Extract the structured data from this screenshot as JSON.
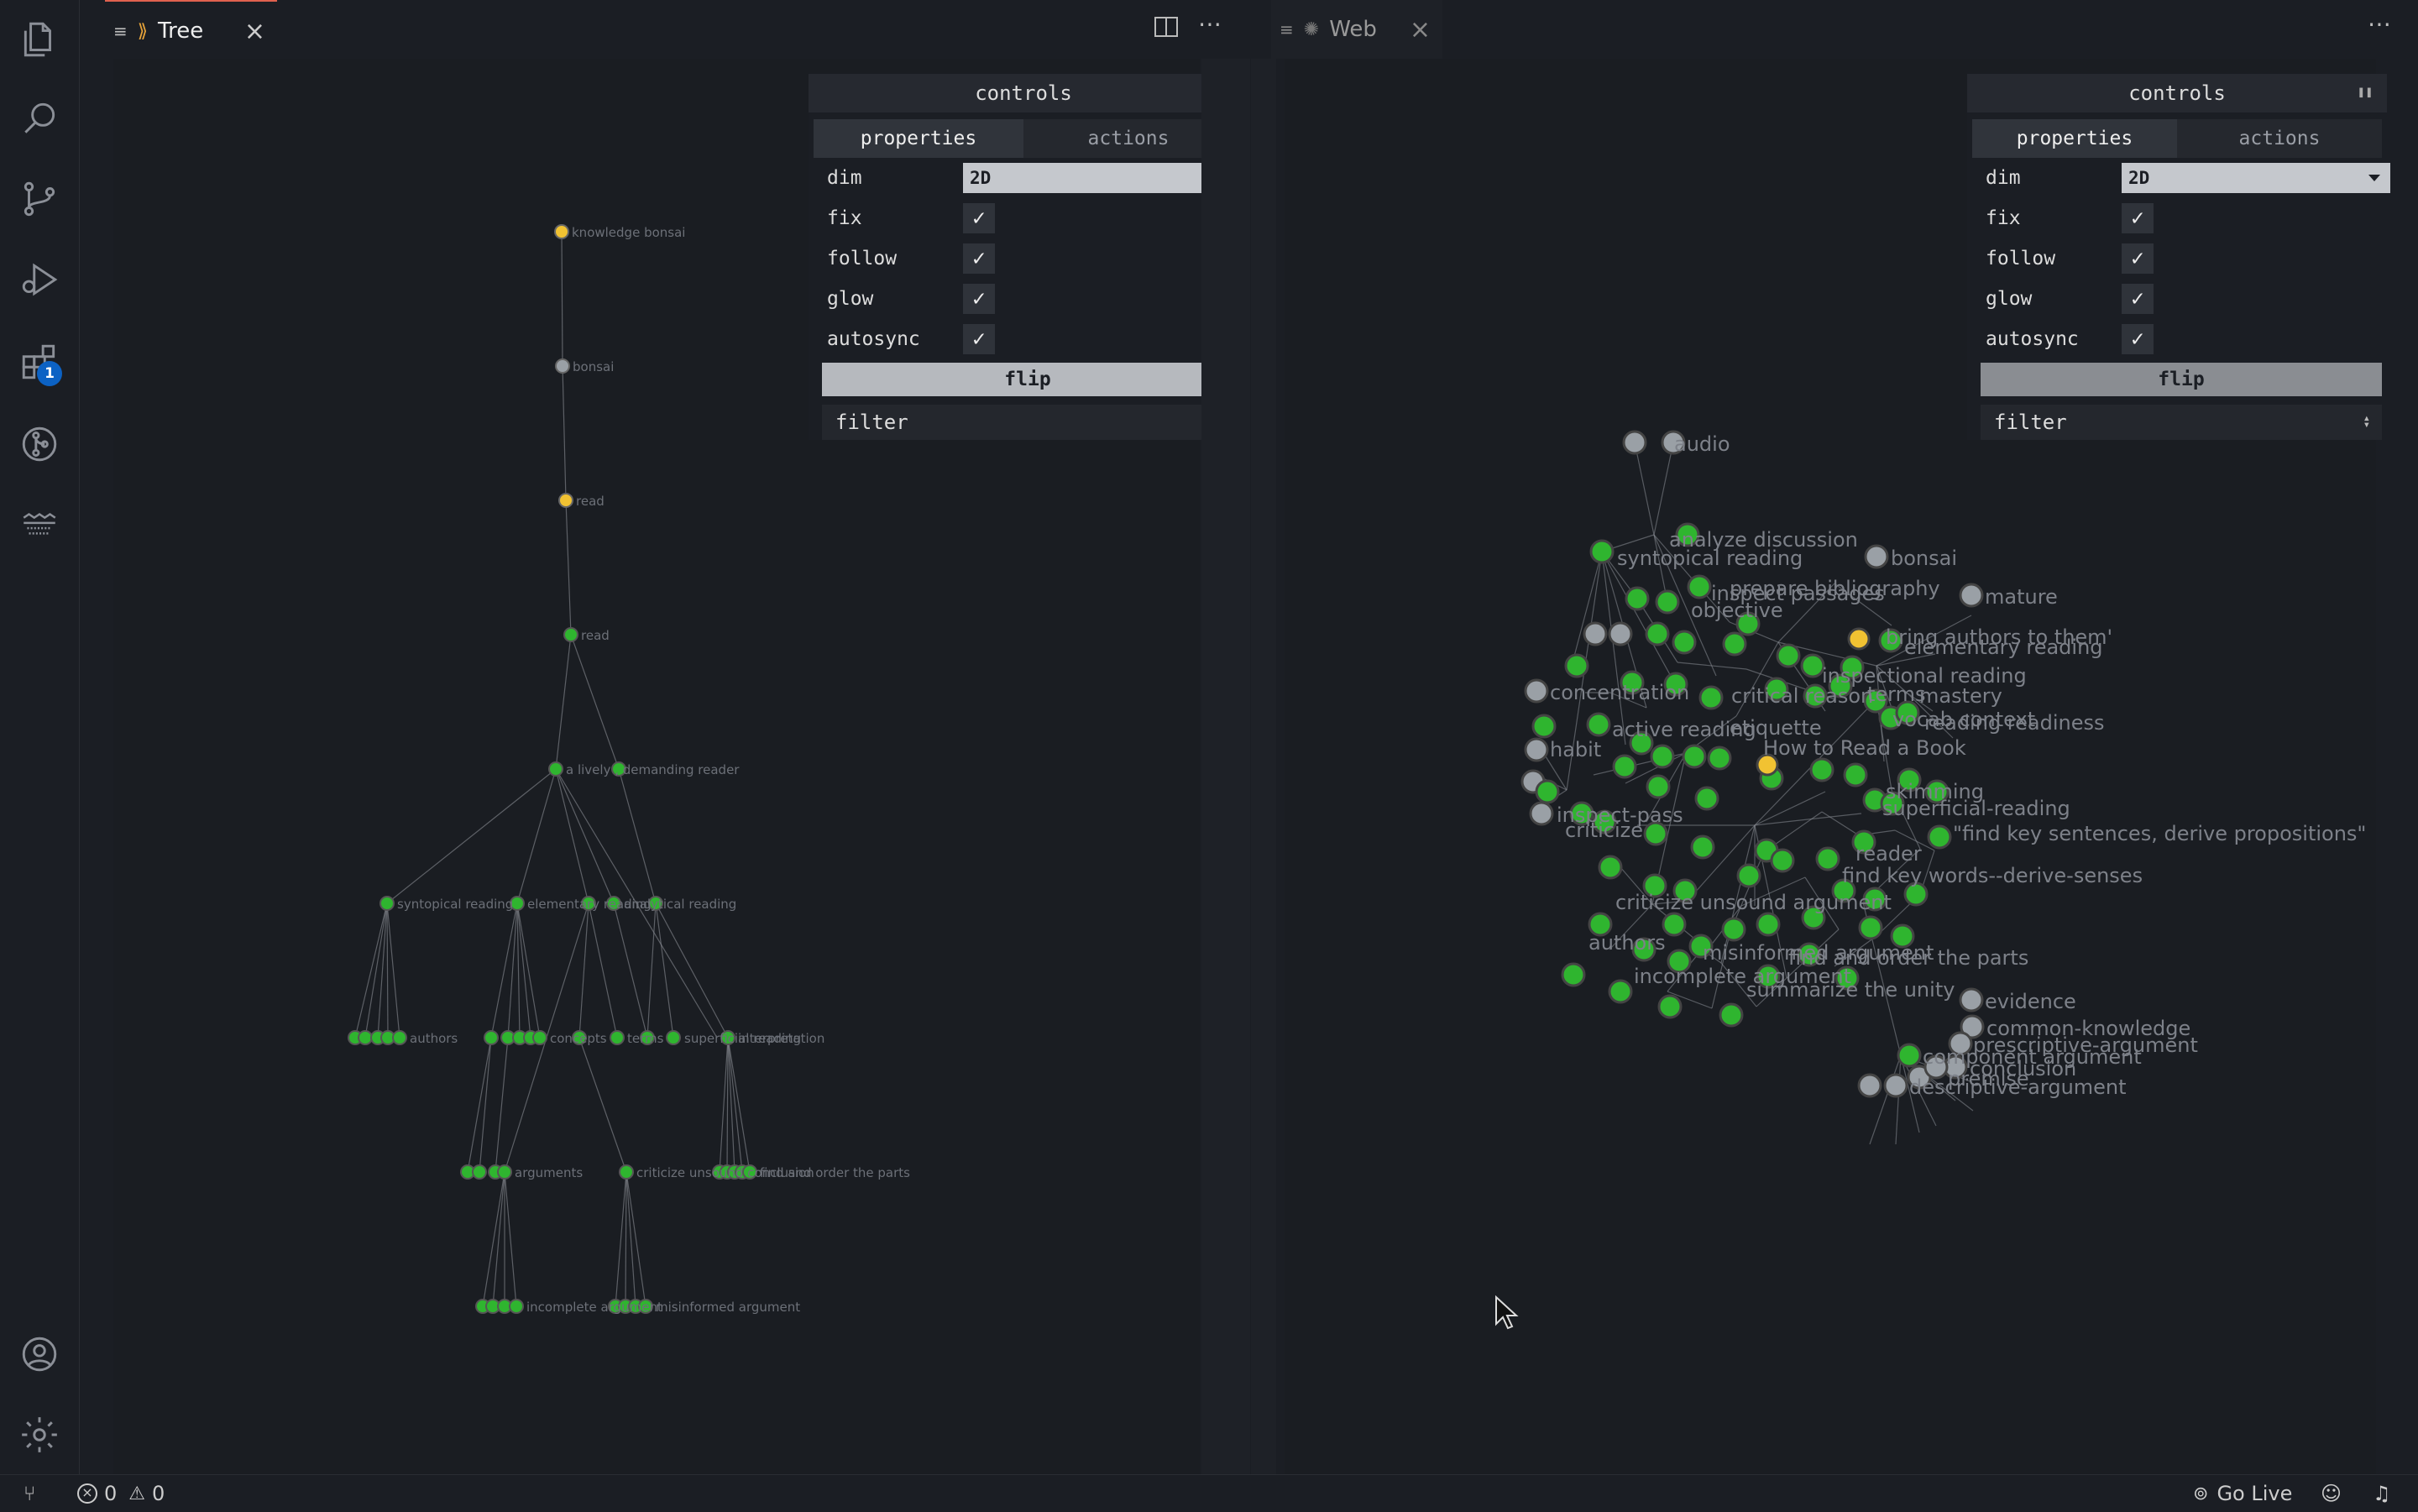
{
  "activity_bar": {
    "icons": [
      "files-icon",
      "search-icon",
      "source-control-icon",
      "run-debug-icon",
      "extensions-icon",
      "git-graph-icon",
      "timeline-icon",
      "account-icon",
      "settings-gear-icon"
    ],
    "extensions_badge": "1"
  },
  "left_pane": {
    "tab_title": "Tree",
    "controls": {
      "title": "controls",
      "tabs": [
        "properties",
        "actions"
      ],
      "dim_label": "dim",
      "dim_value": "2D",
      "toggles": [
        {
          "label": "fix",
          "checked": true
        },
        {
          "label": "follow",
          "checked": true
        },
        {
          "label": "glow",
          "checked": true
        },
        {
          "label": "autosync",
          "checked": true
        }
      ],
      "flip_label": "flip",
      "filter_label": "filter"
    },
    "graph_labels": {
      "root": "knowledge bonsai",
      "bonsai": "bonsai",
      "read1": "read",
      "read2": "read",
      "l4": "a lively , demanding reader",
      "l5a": "syntopical reading",
      "l5b": "elementary reading",
      "l5c": "analytical reading",
      "l6a": "authors",
      "l6b": "concepts",
      "l6c": "terms",
      "l6d": "superficial reading",
      "l6e": "interpretation",
      "l7a": "arguments",
      "l7b": "criticize unsound conclusion",
      "l7c": "find and order the parts",
      "l8a": "incomplete argument",
      "l8b": "misinformed argument"
    }
  },
  "right_pane": {
    "tab_title": "Web",
    "controls": {
      "title": "controls",
      "tabs": [
        "properties",
        "actions"
      ],
      "dim_label": "dim",
      "dim_value": "2D",
      "toggles": [
        {
          "label": "fix",
          "checked": true
        },
        {
          "label": "follow",
          "checked": true
        },
        {
          "label": "glow",
          "checked": true
        },
        {
          "label": "autosync",
          "checked": true
        }
      ],
      "flip_label": "flip",
      "filter_label": "filter"
    },
    "graph_labels": {
      "audio": "audio",
      "analyze": "analyze discussion",
      "syntopical": "syntopical reading",
      "prepare": "prepare bibliography",
      "passages": "inspect passages",
      "objective": "objective",
      "bonsai": "bonsai",
      "mature": "mature",
      "authors_them": "bring authors to them'",
      "elementary": "elementary reading",
      "inspectional": "inspectional reading",
      "concentration": "concentration",
      "habit": "habit",
      "inspect_pass": "inspect-pass",
      "active": "active reading",
      "etiquette": "etiquette",
      "critical": "critical reason",
      "terms": "terms",
      "mastery": "mastery",
      "context": "vocab context",
      "readiness": "reading readiness",
      "howto": "How to Read a Book",
      "skimming": "skimming",
      "superficial": "superficial-reading",
      "find_key": "\"find key sentences, derive propositions\"",
      "criticize": "criticize",
      "reader": "reader",
      "find_words": "find key words--derive-senses",
      "unsound": "criticize unsound argument",
      "authors": "authors",
      "misinformed": "misinformed argument",
      "order": "find and order the parts",
      "incomplete": "incomplete argument",
      "summarize": "summarize the unity",
      "component": "component argument",
      "evidence": "evidence",
      "common": "common-knowledge",
      "prescriptive": "prescriptive-argument",
      "conclusion": "conclusion",
      "premise": "premise",
      "descriptive": "descriptive-argument"
    }
  },
  "status_bar": {
    "errors": "0",
    "warnings": "0",
    "go_live": "Go Live"
  }
}
